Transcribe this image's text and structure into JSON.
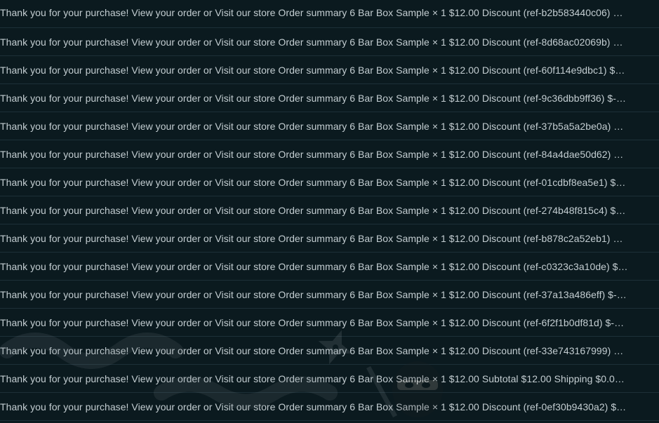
{
  "messages": [
    {
      "snippet": "Thank you for your purchase! View your order or Visit our store Order summary 6 Bar Box Sample × 1 $12.00 Discount (ref-b2b583440c06) …"
    },
    {
      "snippet": "Thank you for your purchase! View your order or Visit our store Order summary 6 Bar Box Sample × 1 $12.00 Discount (ref-8d68ac02069b) …"
    },
    {
      "snippet": "Thank you for your purchase! View your order or Visit our store Order summary 6 Bar Box Sample × 1 $12.00 Discount (ref-60f114e9dbc1) $…"
    },
    {
      "snippet": "Thank you for your purchase! View your order or Visit our store Order summary 6 Bar Box Sample × 1 $12.00 Discount (ref-9c36dbb9ff36) $-…"
    },
    {
      "snippet": "Thank you for your purchase! View your order or Visit our store Order summary 6 Bar Box Sample × 1 $12.00 Discount (ref-37b5a5a2be0a) …"
    },
    {
      "snippet": "Thank you for your purchase! View your order or Visit our store Order summary 6 Bar Box Sample × 1 $12.00 Discount (ref-84a4dae50d62) …"
    },
    {
      "snippet": "Thank you for your purchase! View your order or Visit our store Order summary 6 Bar Box Sample × 1 $12.00 Discount (ref-01cdbf8ea5e1) $…"
    },
    {
      "snippet": "Thank you for your purchase! View your order or Visit our store Order summary 6 Bar Box Sample × 1 $12.00 Discount (ref-274b48f815c4) $…"
    },
    {
      "snippet": "Thank you for your purchase! View your order or Visit our store Order summary 6 Bar Box Sample × 1 $12.00 Discount (ref-b878c2a52eb1) …"
    },
    {
      "snippet": "Thank you for your purchase! View your order or Visit our store Order summary 6 Bar Box Sample × 1 $12.00 Discount (ref-c0323c3a10de) $…"
    },
    {
      "snippet": "Thank you for your purchase! View your order or Visit our store Order summary 6 Bar Box Sample × 1 $12.00 Discount (ref-37a13a486eff) $-…"
    },
    {
      "snippet": "Thank you for your purchase! View your order or Visit our store Order summary 6 Bar Box Sample × 1 $12.00 Discount (ref-6f2f1b0df81d) $-…"
    },
    {
      "snippet": "Thank you for your purchase! View your order or Visit our store Order summary 6 Bar Box Sample × 1 $12.00 Discount (ref-33e743167999) …"
    },
    {
      "snippet": "Thank you for your purchase! View your order or Visit our store Order summary 6 Bar Box Sample × 1 $12.00 Subtotal $12.00 Shipping $0.0…"
    },
    {
      "snippet": "Thank you for your purchase! View your order or Visit our store Order summary 6 Bar Box Sample × 1 $12.00 Discount (ref-0ef30b9430a2) $…"
    }
  ],
  "colors": {
    "background": "#0b1a1f",
    "text": "#c3cdd1",
    "divider": "#1d3038"
  }
}
